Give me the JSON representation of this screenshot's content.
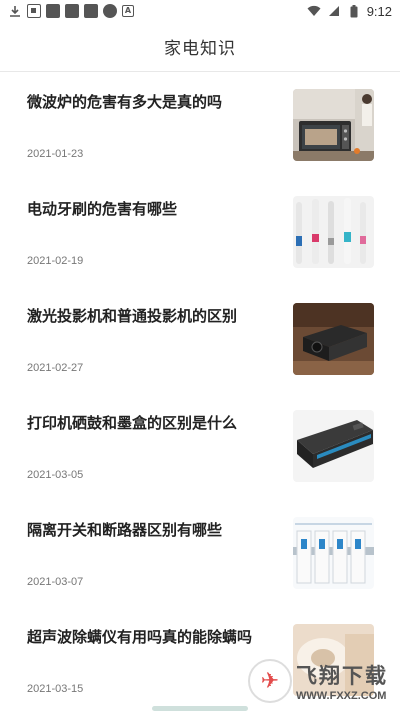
{
  "status_bar": {
    "time": "9:12",
    "left_icons": [
      "download-icon",
      "qr-icon",
      "app-icon",
      "app-icon",
      "app-icon",
      "app-icon",
      "font-a-icon"
    ],
    "right_icons": [
      "wifi-icon",
      "signal-icon",
      "battery-icon"
    ]
  },
  "header": {
    "title": "家电知识"
  },
  "articles": [
    {
      "title": "微波炉的危害有多大是真的吗",
      "date": "2021-01-23",
      "thumb": "microwave-image"
    },
    {
      "title": "电动牙刷的危害有哪些",
      "date": "2021-02-19",
      "thumb": "toothbrush-image"
    },
    {
      "title": "激光投影机和普通投影机的区别",
      "date": "2021-02-27",
      "thumb": "projector-image"
    },
    {
      "title": "打印机硒鼓和墨盒的区别是什么",
      "date": "2021-03-05",
      "thumb": "toner-cartridge-image"
    },
    {
      "title": "隔离开关和断路器区别有哪些",
      "date": "2021-03-07",
      "thumb": "breaker-image"
    },
    {
      "title": "超声波除螨仪有用吗真的能除螨吗",
      "date": "2021-03-15",
      "thumb": "mite-remover-image"
    }
  ],
  "watermark": {
    "brand": "飞翔下载",
    "url": "WWW.FXXZ.COM"
  }
}
